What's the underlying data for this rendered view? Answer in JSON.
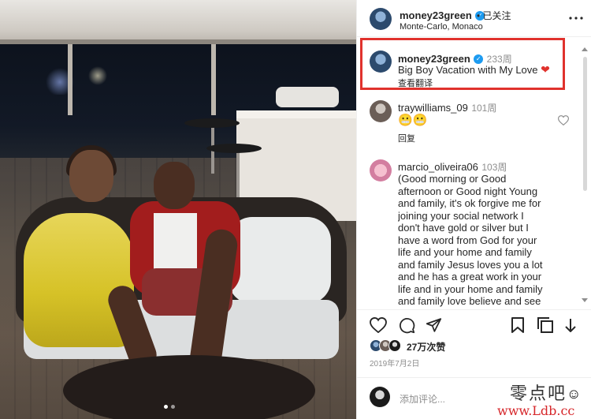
{
  "post": {
    "username": "money23green",
    "verified_icon": "verified-badge-icon",
    "follow_status": "已关注",
    "location": "Monte-Carlo, Monaco"
  },
  "caption": {
    "username": "money23green",
    "age": "233周",
    "text": "Big Boy Vacation with My Love",
    "translate_link": "查看翻译"
  },
  "comments": [
    {
      "username": "traywilliams_09",
      "age": "101周",
      "text": "😬😬",
      "reply_label": "回复"
    },
    {
      "username": "marcio_oliveira06",
      "age": "103周",
      "lines": [
        "(Good morning or Good",
        "afternoon or Good night Young",
        "and family, it's ok forgive me for",
        "joining your social network I",
        "don't have gold or silver but I",
        "have a word from God for your",
        "life and your home and family",
        "and family Jesus loves you a lot",
        "and he has a great work in your",
        "life and in your home and family",
        "and family love believe and see"
      ]
    }
  ],
  "actions": {
    "likes": "27万次赞",
    "date": "2019年7月2日",
    "add_comment_placeholder": "添加评论..."
  },
  "watermark": {
    "line1": "零点吧",
    "line2": "www.Ldb.cc"
  },
  "colors": {
    "accent_red": "#e0322d",
    "verified_blue": "#1d9bf0",
    "watermark_red": "#d6262a"
  }
}
